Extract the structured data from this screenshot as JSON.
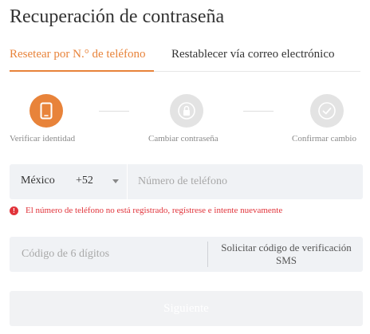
{
  "page": {
    "title": "Recuperación de contraseña"
  },
  "tabs": [
    {
      "label": "Resetear por N.° de teléfono",
      "active": true
    },
    {
      "label": "Restablecer vía correo electrónico",
      "active": false
    }
  ],
  "steps": [
    {
      "label": "Verificar identidad",
      "icon": "smartphone-icon",
      "active": true
    },
    {
      "label": "Cambiar contraseña",
      "icon": "lock-icon",
      "active": false
    },
    {
      "label": "Confirmar cambio",
      "icon": "check-circle-icon",
      "active": false
    }
  ],
  "phone": {
    "country": "México",
    "dial_code": "+52",
    "placeholder": "Número de teléfono",
    "value": ""
  },
  "error": {
    "icon": "error-icon",
    "icon_glyph": "!",
    "message": "El número de teléfono no está registrado, regístrese e intente nuevamente"
  },
  "code": {
    "placeholder": "Código de 6 dígitos",
    "value": "",
    "sms_button_label": "Solicitar código de verificación SMS"
  },
  "submit": {
    "label": "Siguiente"
  },
  "colors": {
    "accent": "#e8833a",
    "error": "#e1343b",
    "field_background": "#f0f2f5",
    "inactive_step": "#e3e3e3"
  }
}
